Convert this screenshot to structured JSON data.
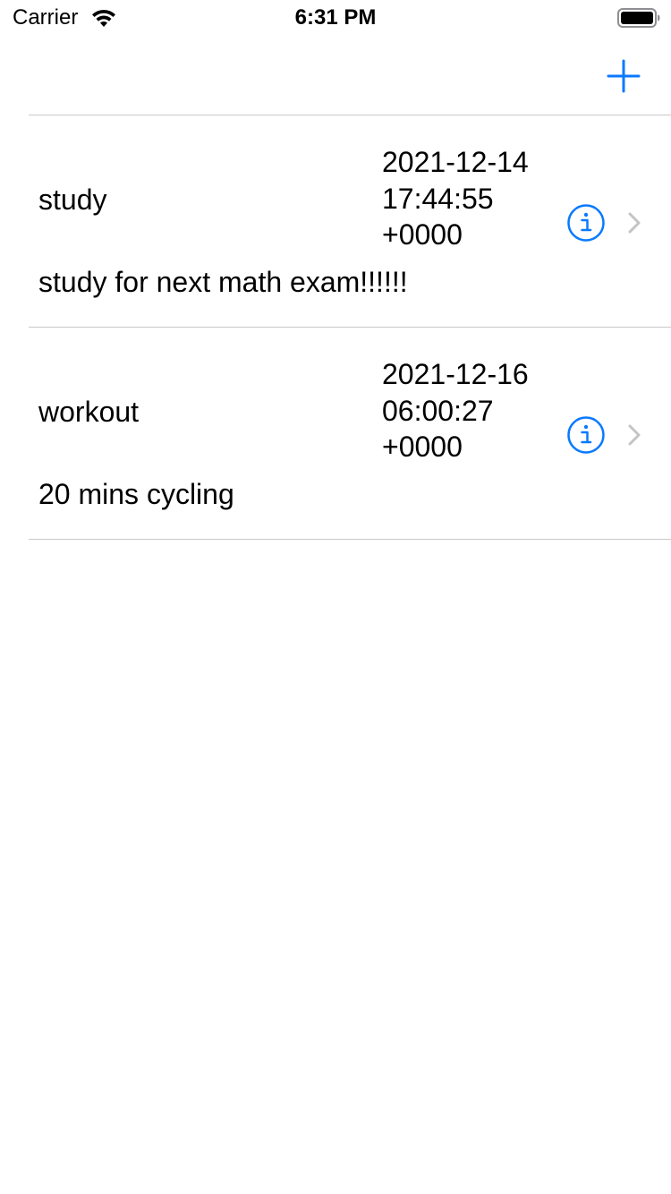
{
  "status_bar": {
    "carrier": "Carrier",
    "time": "6:31 PM"
  },
  "nav": {
    "add_icon": "plus-icon"
  },
  "colors": {
    "accent": "#0a7aff",
    "separator": "#c8c7cc",
    "chevron": "#c4c4c7"
  },
  "items": [
    {
      "title": "study",
      "date": "2021-12-14 17:44:55 +0000",
      "description": "study for next math exam!!!!!!"
    },
    {
      "title": "workout",
      "date": "2021-12-16 06:00:27 +0000",
      "description": "20 mins cycling"
    }
  ]
}
